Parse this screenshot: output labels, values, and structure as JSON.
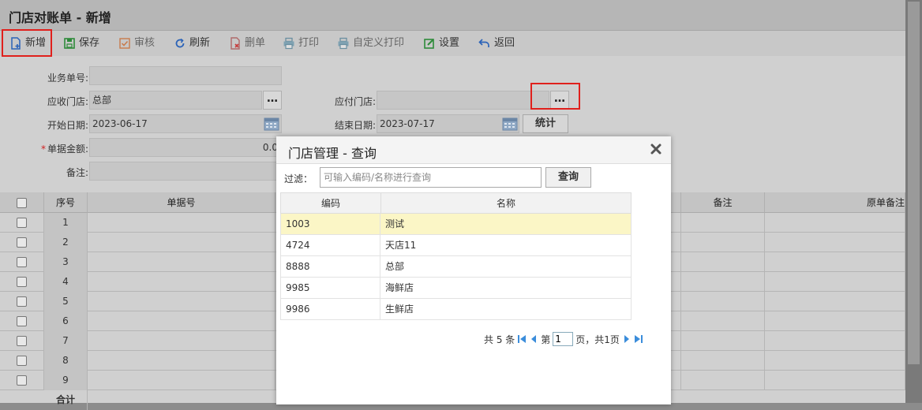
{
  "page": {
    "title": "门店对账单 - 新增"
  },
  "toolbar": {
    "add": "新增",
    "save": "保存",
    "audit": "审核",
    "refresh": "刷新",
    "delete": "删单",
    "print": "打印",
    "custom_print": "自定义打印",
    "settings": "设置",
    "back": "返回"
  },
  "form": {
    "doc_no_label": "业务单号:",
    "doc_no_value": "",
    "recv_store_label": "应收门店:",
    "recv_store_value": "总部",
    "pay_store_label": "应付门店:",
    "pay_store_value": "",
    "start_date_label": "开始日期:",
    "start_date_value": "2023-06-17",
    "end_date_label": "结束日期:",
    "end_date_value": "2023-07-17",
    "stat_button": "统计",
    "amount_label": "单据金额:",
    "amount_required": "*",
    "amount_value": "0.0",
    "remark_label": "备注:",
    "remark_value": ""
  },
  "grid": {
    "headers": [
      "序号",
      "单据号",
      "备注",
      "原单备注"
    ],
    "rows": [
      "1",
      "2",
      "3",
      "4",
      "5",
      "6",
      "7",
      "8",
      "9"
    ],
    "footer_label": "合计"
  },
  "dialog": {
    "title": "门店管理 - 查询",
    "filter_label": "过滤：",
    "filter_placeholder": "可输入编码/名称进行查询",
    "query_button": "查询",
    "columns": [
      "编码",
      "名称"
    ],
    "rows": [
      {
        "code": "1003",
        "name": "测试"
      },
      {
        "code": "4724",
        "name": "天店11"
      },
      {
        "code": "8888",
        "name": "总部"
      },
      {
        "code": "9985",
        "name": "海鲜店"
      },
      {
        "code": "9986",
        "name": "生鲜店"
      }
    ],
    "pager": {
      "total": "共 5 条",
      "page_prefix": "第",
      "page_value": "1",
      "page_suffix": "页，共1页"
    }
  },
  "colors": {
    "highlight": "#e0201c",
    "selected_row": "#fbf6c6"
  }
}
